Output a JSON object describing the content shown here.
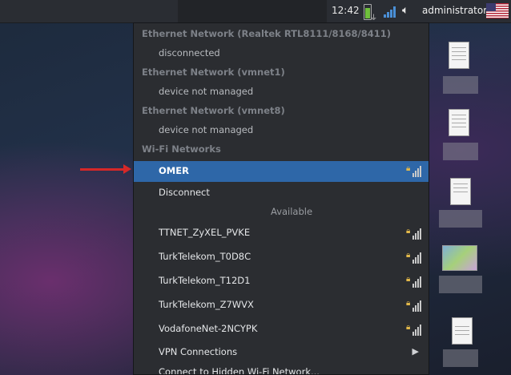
{
  "panel": {
    "clock": "12:42",
    "user": "administrator",
    "icons": [
      "battery-icon",
      "network-signal-icon",
      "volume-icon",
      "us-flag-icon"
    ]
  },
  "menu": {
    "sections": [
      {
        "header": "Ethernet Network (Realtek RTL8111/8168/8411)",
        "status": "disconnected"
      },
      {
        "header": "Ethernet Network (vmnet1)",
        "status": "device not managed"
      },
      {
        "header": "Ethernet Network (vmnet8)",
        "status": "device not managed"
      }
    ],
    "wifi_header": "Wi-Fi Networks",
    "connected": "OMER",
    "disconnect": "Disconnect",
    "available_label": "Available",
    "networks": [
      "TTNET_ZyXEL_PVKE",
      "TurkTelekom_T0D8C",
      "TurkTelekom_T12D1",
      "TurkTelekom_Z7WVX",
      "VodafoneNet-2NCYPK"
    ],
    "vpn": "VPN Connections",
    "hidden": "Connect to Hidden Wi-Fi Network..."
  }
}
